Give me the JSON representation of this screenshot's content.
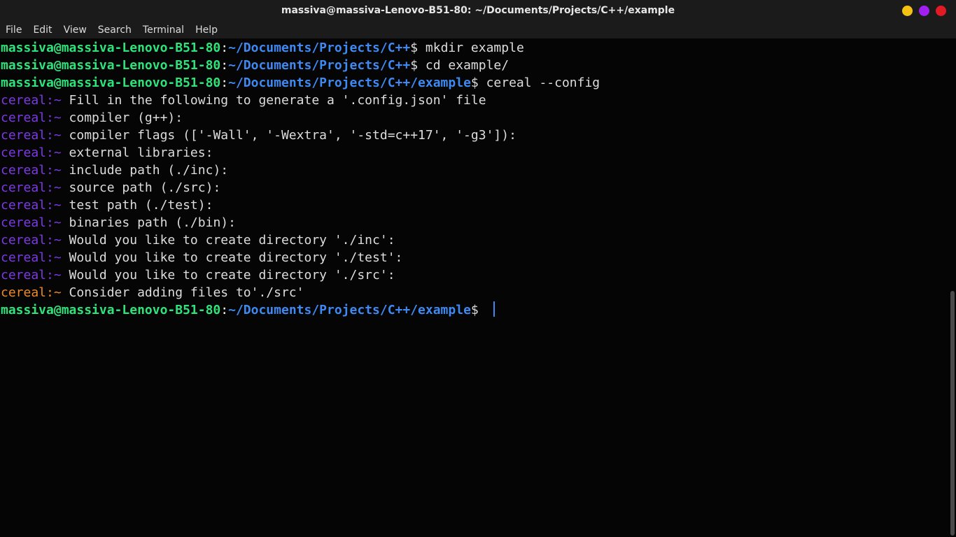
{
  "window": {
    "title": "massiva@massiva-Lenovo-B51-80: ~/Documents/Projects/C++/example",
    "buttons": [
      {
        "name": "minimize",
        "color": "#f5c211"
      },
      {
        "name": "maximize",
        "color": "#a020f0"
      },
      {
        "name": "close",
        "color": "#e01b24"
      }
    ]
  },
  "menu": [
    "File",
    "Edit",
    "View",
    "Search",
    "Terminal",
    "Help"
  ],
  "colors": {
    "user": "#2ee47a",
    "path": "#3f89f2",
    "cereal": "#7d39e7",
    "cereal_warn": "#f08a24",
    "text": "#dddddd",
    "background": "#050505"
  },
  "terminal": {
    "lines": [
      {
        "type": "prompt",
        "user": "massiva@massiva-Lenovo-B51-80",
        "path": "~/Documents/Projects/C++",
        "cmd": " mkdir example"
      },
      {
        "type": "prompt",
        "user": "massiva@massiva-Lenovo-B51-80",
        "path": "~/Documents/Projects/C++",
        "cmd": " cd example/"
      },
      {
        "type": "prompt",
        "user": "massiva@massiva-Lenovo-B51-80",
        "path": "~/Documents/Projects/C++/example",
        "cmd": " cereal --config"
      },
      {
        "type": "cereal",
        "msg": "Fill in the following to generate a '.config.json' file"
      },
      {
        "type": "cereal",
        "msg": "compiler (g++):"
      },
      {
        "type": "cereal",
        "msg": "compiler flags (['-Wall', '-Wextra', '-std=c++17', '-g3']):"
      },
      {
        "type": "cereal",
        "msg": "external libraries:"
      },
      {
        "type": "cereal",
        "msg": "include path (./inc):"
      },
      {
        "type": "cereal",
        "msg": "source path (./src):"
      },
      {
        "type": "cereal",
        "msg": "test path (./test):"
      },
      {
        "type": "cereal",
        "msg": "binaries path (./bin):"
      },
      {
        "type": "cereal",
        "msg": "Would you like to create directory './inc':"
      },
      {
        "type": "cereal",
        "msg": "Would you like to create directory './test':"
      },
      {
        "type": "cereal",
        "msg": "Would you like to create directory './src':"
      },
      {
        "type": "cereal-warn",
        "msg": "Consider adding files to'./src'"
      },
      {
        "type": "prompt",
        "user": "massiva@massiva-Lenovo-B51-80",
        "path": "~/Documents/Projects/C++/example",
        "cmd": " ",
        "cursor": true
      }
    ],
    "cereal_prefix": "cereal:",
    "tilde": "~"
  }
}
